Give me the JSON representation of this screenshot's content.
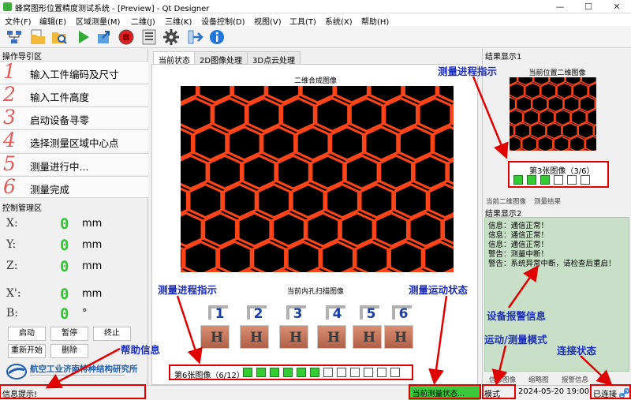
{
  "window": {
    "title": "蜂窝图形位置精度测试系统 - [Preview] - Qt Designer"
  },
  "menu": [
    "文件(F)",
    "编辑(E)",
    "区域测量(M)",
    "二维(J)",
    "三维(K)",
    "设备控制(D)",
    "视图(V)",
    "工具(T)",
    "系统(X)",
    "帮助(H)"
  ],
  "toolbar_icons": [
    "connect-icon",
    "folder-icon",
    "search-folder-icon",
    "play-icon",
    "export-icon",
    "stop-icon",
    "list-icon",
    "gear-icon",
    "arrow-right-icon",
    "info-icon"
  ],
  "left": {
    "nav_title": "操作导引区",
    "steps": [
      {
        "num": "1",
        "label": "输入工件编码及尺寸"
      },
      {
        "num": "2",
        "label": "输入工件高度"
      },
      {
        "num": "3",
        "label": "启动设备寻零"
      },
      {
        "num": "4",
        "label": "选择测量区域中心点"
      },
      {
        "num": "5",
        "label": "测量进行中..."
      },
      {
        "num": "6",
        "label": "测量完成"
      }
    ],
    "ctrl_title": "控制管理区",
    "coords": [
      {
        "axis": "X:",
        "value": "0",
        "unit": "mm"
      },
      {
        "axis": "Y:",
        "value": "0",
        "unit": "mm"
      },
      {
        "axis": "Z:",
        "value": "0",
        "unit": "mm"
      },
      {
        "axis": "X':",
        "value": "0",
        "unit": "mm"
      },
      {
        "axis": "B:",
        "value": "0",
        "unit": "°"
      }
    ],
    "buttons": {
      "start": "启动",
      "pause": "暂停",
      "stop": "终止",
      "restart": "重新开始",
      "delete": "删除"
    },
    "org_name": "航空工业济南特种结构研究所"
  },
  "center": {
    "tabs": [
      "当前状态",
      "2D图像处理",
      "3D点云处理"
    ],
    "main_caption": "二维合成图像",
    "scan_caption": "当前内孔扫描图像",
    "digits": [
      "1",
      "2",
      "3",
      "4",
      "5",
      "6"
    ],
    "thumb_letter": "H",
    "progress_text": "第6张图像（6/12）",
    "progress_done": 6,
    "progress_total": 12
  },
  "right": {
    "result1_title": "结果显示1",
    "current_caption": "当前位置二维图像",
    "progress_text": "第3张图像（3/6）",
    "progress_done": 3,
    "progress_total": 6,
    "tabs1": [
      "当前二维图像",
      "测量结果"
    ],
    "result2_title": "结果显示2",
    "messages": [
      "信息：通信正常！",
      "信息：通信正常！",
      "信息：通信正常！",
      "警告：测量中断！",
      "警告：系统异常中断，请检查后重启！"
    ],
    "tabs2": [
      "信息图像",
      "缩略图",
      "报警信息"
    ]
  },
  "status": {
    "hint": "信息提示!",
    "measure_state": "当前测量状态...",
    "mode": "模式",
    "datetime": "2024-05-20 19:00",
    "connection": "已连接"
  },
  "annotations": {
    "measure_progress": "测量进程指示",
    "measure_motion": "测量运动状态",
    "help_info": "帮助信息",
    "alarm_info": "设备报警信息",
    "motion_mode": "运动/测量模式",
    "connection_state": "连接状态"
  },
  "colors": {
    "accent_red": "#e00000",
    "digit_green": "#2ec52e",
    "annotation_blue": "#1e2eb8",
    "step_number": "#e35b5b",
    "message_bg": "#c7e0c7"
  }
}
